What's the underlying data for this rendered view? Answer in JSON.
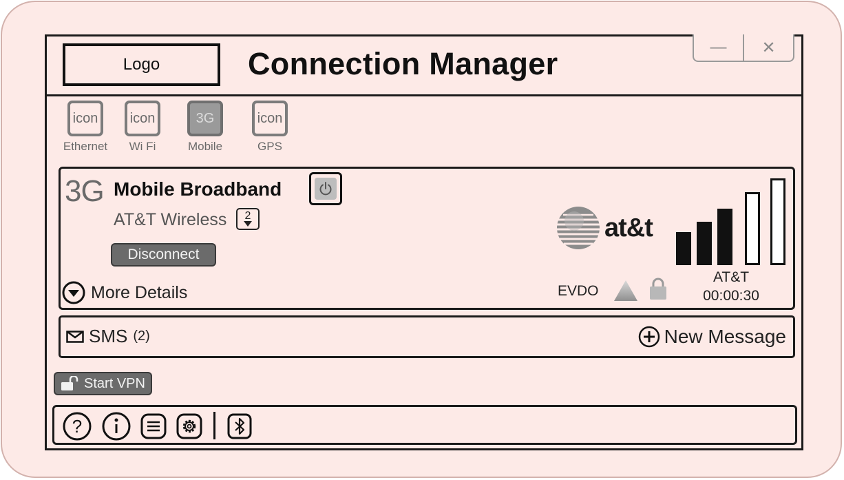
{
  "window": {
    "logo_label": "Logo",
    "title": "Connection Manager",
    "controls": {
      "minimize": "—",
      "close": "✕"
    }
  },
  "connection_types": [
    {
      "icon_text": "icon",
      "label": "Ethernet",
      "active": false
    },
    {
      "icon_text": "icon",
      "label": "Wi Fi",
      "active": false
    },
    {
      "icon_text": "3G",
      "label": "Mobile",
      "active": true
    },
    {
      "icon_text": "icon",
      "label": "GPS",
      "active": false
    }
  ],
  "mobile": {
    "network_type": "3G",
    "title": "Mobile Broadband",
    "carrier": "AT&T Wireless",
    "carrier_count": "2",
    "disconnect_label": "Disconnect",
    "more_details_label": "More Details",
    "brand_logo_text": "at&t",
    "technology": "EVDO",
    "signal_carrier": "AT&T",
    "connection_time": "00:00:30",
    "signal_strength": {
      "bars_on": 3,
      "bars_total": 5
    }
  },
  "sms": {
    "label": "SMS",
    "count": "(2)",
    "new_message_label": "New Message"
  },
  "vpn": {
    "label": "Start VPN"
  },
  "toolbar": {
    "icons": [
      "help-icon",
      "info-icon",
      "list-icon",
      "settings-icon",
      "bluetooth-icon"
    ]
  },
  "colors": {
    "background": "#fdeae7",
    "border": "#1b1b1b",
    "button_fill": "#6b6b6b",
    "muted_text": "#6a6a6a"
  }
}
